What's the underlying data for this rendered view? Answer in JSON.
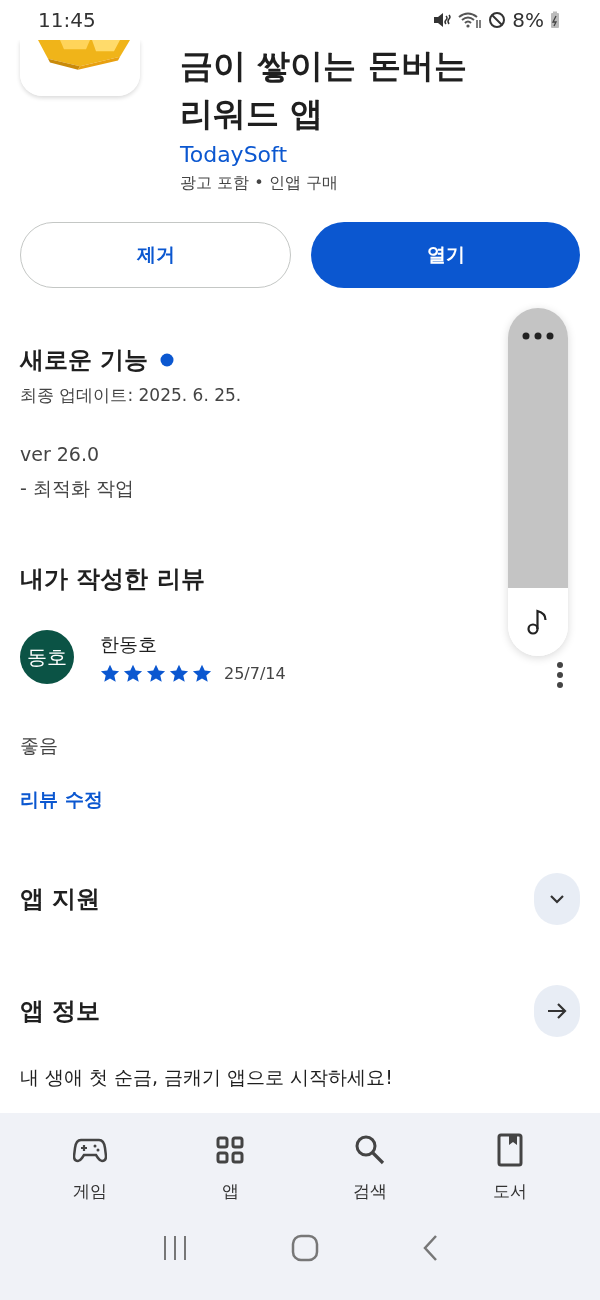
{
  "status_bar": {
    "time": "11:45",
    "battery": "8%"
  },
  "app": {
    "title_lines": [
      "금이 쌓이는 돈버는",
      "리워드 앱"
    ],
    "developer": "TodaySoft",
    "meta": "광고 포함 • 인앱 구매"
  },
  "buttons": [
    {
      "label": "제거",
      "kind": "outline"
    },
    {
      "label": "열기",
      "kind": "filled"
    }
  ],
  "whats_new": {
    "title": "새로운 기능",
    "updated": "최종 업데이트: 2025. 6. 25.",
    "notes": [
      "ver 26.0",
      "- 최적화 작업"
    ]
  },
  "my_review": {
    "title": "내가 작성한 리뷰",
    "avatar": "동호",
    "name": "한동호",
    "stars": 5,
    "date": "25/7/14",
    "text": "좋음",
    "edit_link": "리뷰 수정"
  },
  "sections": [
    {
      "title": "앱 지원",
      "kind": "expand"
    },
    {
      "title": "앱 정보",
      "kind": "arrow"
    }
  ],
  "description": "내 생애 첫 순금, 금캐기 앱으로 시작하세요!",
  "bottom_nav": [
    {
      "label": "게임",
      "selected": false
    },
    {
      "label": "앱",
      "selected": false
    },
    {
      "label": "검색",
      "selected": false
    },
    {
      "label": "도서",
      "selected": false
    }
  ]
}
